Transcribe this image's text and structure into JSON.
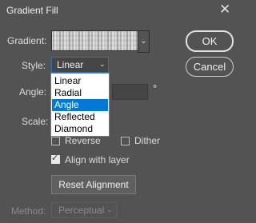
{
  "dialog": {
    "title": "Gradient Fill",
    "close_glyph": "✕"
  },
  "buttons": {
    "ok": "OK",
    "cancel": "Cancel",
    "reset_alignment": "Reset Alignment"
  },
  "labels": {
    "gradient": "Gradient:",
    "style": "Style:",
    "angle": "Angle:",
    "scale": "Scale:",
    "method": "Method:",
    "degree_symbol": "°"
  },
  "style_select": {
    "value": "Linear",
    "options": [
      "Linear",
      "Radial",
      "Angle",
      "Reflected",
      "Diamond"
    ],
    "highlighted": "Angle"
  },
  "checkboxes": {
    "reverse": {
      "label": "Reverse",
      "checked": false
    },
    "dither": {
      "label": "Dither",
      "checked": false
    },
    "align_with_layer": {
      "label": "Align with layer",
      "checked": true
    }
  },
  "method_select": {
    "value": "Perceptual"
  },
  "icons": {
    "chevron_down": "⌄",
    "checkmark": "✓"
  }
}
